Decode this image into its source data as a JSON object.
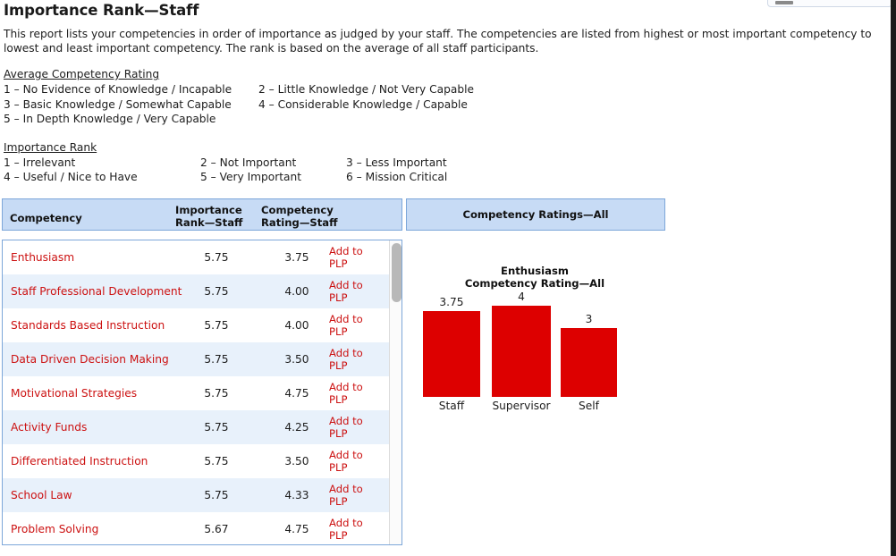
{
  "page": {
    "title": "Importance Rank—Staff",
    "intro": "This report lists your competencies in order of importance as judged by your staff. The competencies are listed from highest or most important competency to lowest and least important competency. The rank is based on the average of all staff participants."
  },
  "legends": {
    "rating": {
      "heading": "Average Competency Rating",
      "rows": [
        [
          "1 – No Evidence of Knowledge / Incapable",
          "2 – Little Knowledge / Not Very Capable"
        ],
        [
          "3 – Basic Knowledge / Somewhat Capable",
          "4 – Considerable Knowledge / Capable"
        ],
        [
          "5 – In Depth Knowledge / Very Capable",
          ""
        ]
      ]
    },
    "rank": {
      "heading": "Importance Rank",
      "rows": [
        [
          "1 – Irrelevant",
          "2 – Not Important",
          "3 – Less Important"
        ],
        [
          "4 – Useful / Nice to Have",
          "5 – Very Important",
          "6 – Mission Critical"
        ]
      ]
    }
  },
  "table": {
    "headers": {
      "competency": "Competency",
      "rank": "Importance Rank—Staff",
      "rank_l1": "Importance",
      "rank_l2": "Rank—Staff",
      "rating": "Competency Rating—Staff",
      "rating_l1": "Competency",
      "rating_l2": "Rating—Staff",
      "chart": "Competency Ratings—All"
    },
    "action_label": "Add to PLP",
    "rows": [
      {
        "competency": "Enthusiasm",
        "rank": "5.75",
        "rating": "3.75",
        "action": "Add to PLP"
      },
      {
        "competency": "Staff Professional Development",
        "rank": "5.75",
        "rating": "4.00",
        "action": "Add to PLP"
      },
      {
        "competency": "Standards Based Instruction",
        "rank": "5.75",
        "rating": "4.00",
        "action": "Add to PLP"
      },
      {
        "competency": "Data Driven Decision Making",
        "rank": "5.75",
        "rating": "3.50",
        "action": "Add to PLP"
      },
      {
        "competency": "Motivational Strategies",
        "rank": "5.75",
        "rating": "4.75",
        "action": "Add to PLP"
      },
      {
        "competency": "Activity Funds",
        "rank": "5.75",
        "rating": "4.25",
        "action": "Add to PLP"
      },
      {
        "competency": "Differentiated Instruction",
        "rank": "5.75",
        "rating": "3.50",
        "action": "Add to PLP"
      },
      {
        "competency": "School Law",
        "rank": "5.75",
        "rating": "4.33",
        "action": "Add to PLP"
      },
      {
        "competency": "Problem Solving",
        "rank": "5.67",
        "rating": "4.75",
        "action": "Add to PLP"
      }
    ]
  },
  "chart_data": {
    "type": "bar",
    "title": "Enthusiasm\nCompetency Rating—All",
    "title_line1": "Enthusiasm",
    "title_line2": "Competency Rating—All",
    "categories": [
      "Staff",
      "Supervisor",
      "Self"
    ],
    "values": [
      3.75,
      4,
      3
    ],
    "value_labels": [
      "3.75",
      "4",
      "3"
    ],
    "series": [
      {
        "name": "Competency Rating—All",
        "values": [
          3.75,
          4,
          3
        ]
      }
    ],
    "xlabel": "",
    "ylabel": "",
    "ylim": [
      0,
      5
    ],
    "grid": false,
    "legend": "none",
    "bar_color": "#dd0000"
  },
  "colors": {
    "header_fill": "#c7dbf5",
    "header_border": "#7da7d9",
    "row_alt": "#e8f1fb",
    "link_red": "#cc1111",
    "bar_red": "#dd0000"
  }
}
